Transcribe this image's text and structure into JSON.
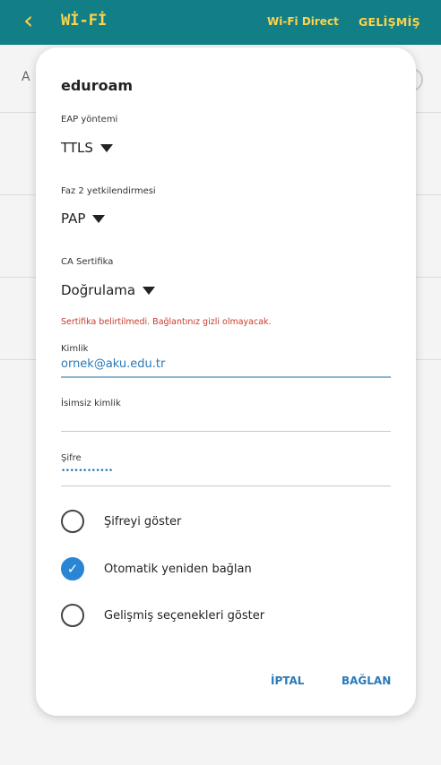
{
  "appbar": {
    "back_icon": "chevron-left-icon",
    "title": "Wİ-Fİ",
    "action_direct": "Wi-Fi Direct",
    "action_advanced": "GELİŞMİŞ",
    "color": "#127f86",
    "accent": "#ffd34a"
  },
  "background": {
    "first_letter": "A"
  },
  "dialog": {
    "title": "eduroam",
    "eap_method": {
      "label": "EAP yöntemi",
      "value": "TTLS"
    },
    "phase2": {
      "label": "Faz 2 yetkilendirmesi",
      "value": "PAP"
    },
    "ca_cert": {
      "label": "CA Sertifika",
      "value": "Doğrulama"
    },
    "warning": "Sertifika belirtilmedi. Bağlantınız gizli olmayacak.",
    "identity": {
      "label": "Kimlik",
      "value": "ornek@aku.edu.tr"
    },
    "anon_identity": {
      "label": "İsimsiz kimlik",
      "value": ""
    },
    "password": {
      "label": "Şifre",
      "value": "••••••••••••"
    },
    "options": [
      {
        "label": "Şifreyi göster",
        "checked": false
      },
      {
        "label": "Otomatik yeniden bağlan",
        "checked": true
      },
      {
        "label": "Gelişmiş seçenekleri göster",
        "checked": false
      }
    ],
    "cancel_label": "İPTAL",
    "connect_label": "BAĞLAN",
    "accent": "#2a86d4",
    "warning_color": "#c83a2c"
  }
}
